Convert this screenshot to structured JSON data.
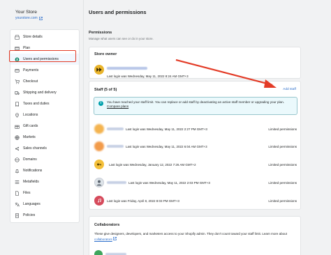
{
  "store": {
    "name": "Your Store",
    "link": "yourstore.com"
  },
  "sidebar": {
    "items": [
      {
        "label": "Store details",
        "icon": "store-icon"
      },
      {
        "label": "Plan",
        "icon": "plan-icon"
      },
      {
        "label": "Users and permissions",
        "icon": "user-icon",
        "active": true
      },
      {
        "label": "Payments",
        "icon": "payments-icon"
      },
      {
        "label": "Checkout",
        "icon": "cart-icon"
      },
      {
        "label": "Shipping and delivery",
        "icon": "truck-icon"
      },
      {
        "label": "Taxes and duties",
        "icon": "taxes-icon"
      },
      {
        "label": "Locations",
        "icon": "location-icon"
      },
      {
        "label": "Gift cards",
        "icon": "gift-icon"
      },
      {
        "label": "Markets",
        "icon": "globe-icon"
      },
      {
        "label": "Sales channels",
        "icon": "channels-icon"
      },
      {
        "label": "Domains",
        "icon": "domain-icon"
      },
      {
        "label": "Notifications",
        "icon": "bell-icon"
      },
      {
        "label": "Metafields",
        "icon": "metafields-icon"
      },
      {
        "label": "Files",
        "icon": "file-icon"
      },
      {
        "label": "Languages",
        "icon": "language-icon"
      },
      {
        "label": "Policies",
        "icon": "policy-icon"
      }
    ]
  },
  "main": {
    "title": "Users and permissions",
    "section_title": "Permissions",
    "section_sub": "Manage what users can see or do in your store.",
    "owner": {
      "title": "Store owner",
      "last_login": "Last login was Wednesday, May 11, 2022 8:24 AM GMT+3"
    },
    "staff": {
      "title": "Staff (5 of 5)",
      "add_label": "Add staff",
      "banner_text": "You have reached your staff limit. You can replace or add staff by deactivating an active staff member or upgrading your plan.",
      "banner_link": "Compare plans",
      "rows": [
        {
          "last_login": "Last login was Wednesday, May 11, 2022 2:27 PM GMT+3",
          "permission": "Limited permissions"
        },
        {
          "last_login": "Last login was Wednesday, May 11, 2022 6:04 AM GMT+3",
          "permission": "Limited permissions"
        },
        {
          "last_login": "Last login was Wednesday, January 12, 2022 7:26 AM GMT+2",
          "permission": "Limited permissions"
        },
        {
          "last_login": "Last login was Wednesday, May 11, 2022 2:03 PM GMT+3",
          "permission": "Limited permissions"
        },
        {
          "last_login": "Last login was Friday, April 8, 2022 8:03 PM GMT+3",
          "permission": "Limited permissions"
        }
      ]
    },
    "collaborators": {
      "title": "Collaborators",
      "text_before": "These give designers, developers, and marketers access to your Shopify admin. They don't count toward your staff limit. Learn more about",
      "link": "collaborators"
    }
  },
  "colors": {
    "accent": "#2c6ecb",
    "highlight": "#e33b26",
    "active_icon": "#008060"
  }
}
